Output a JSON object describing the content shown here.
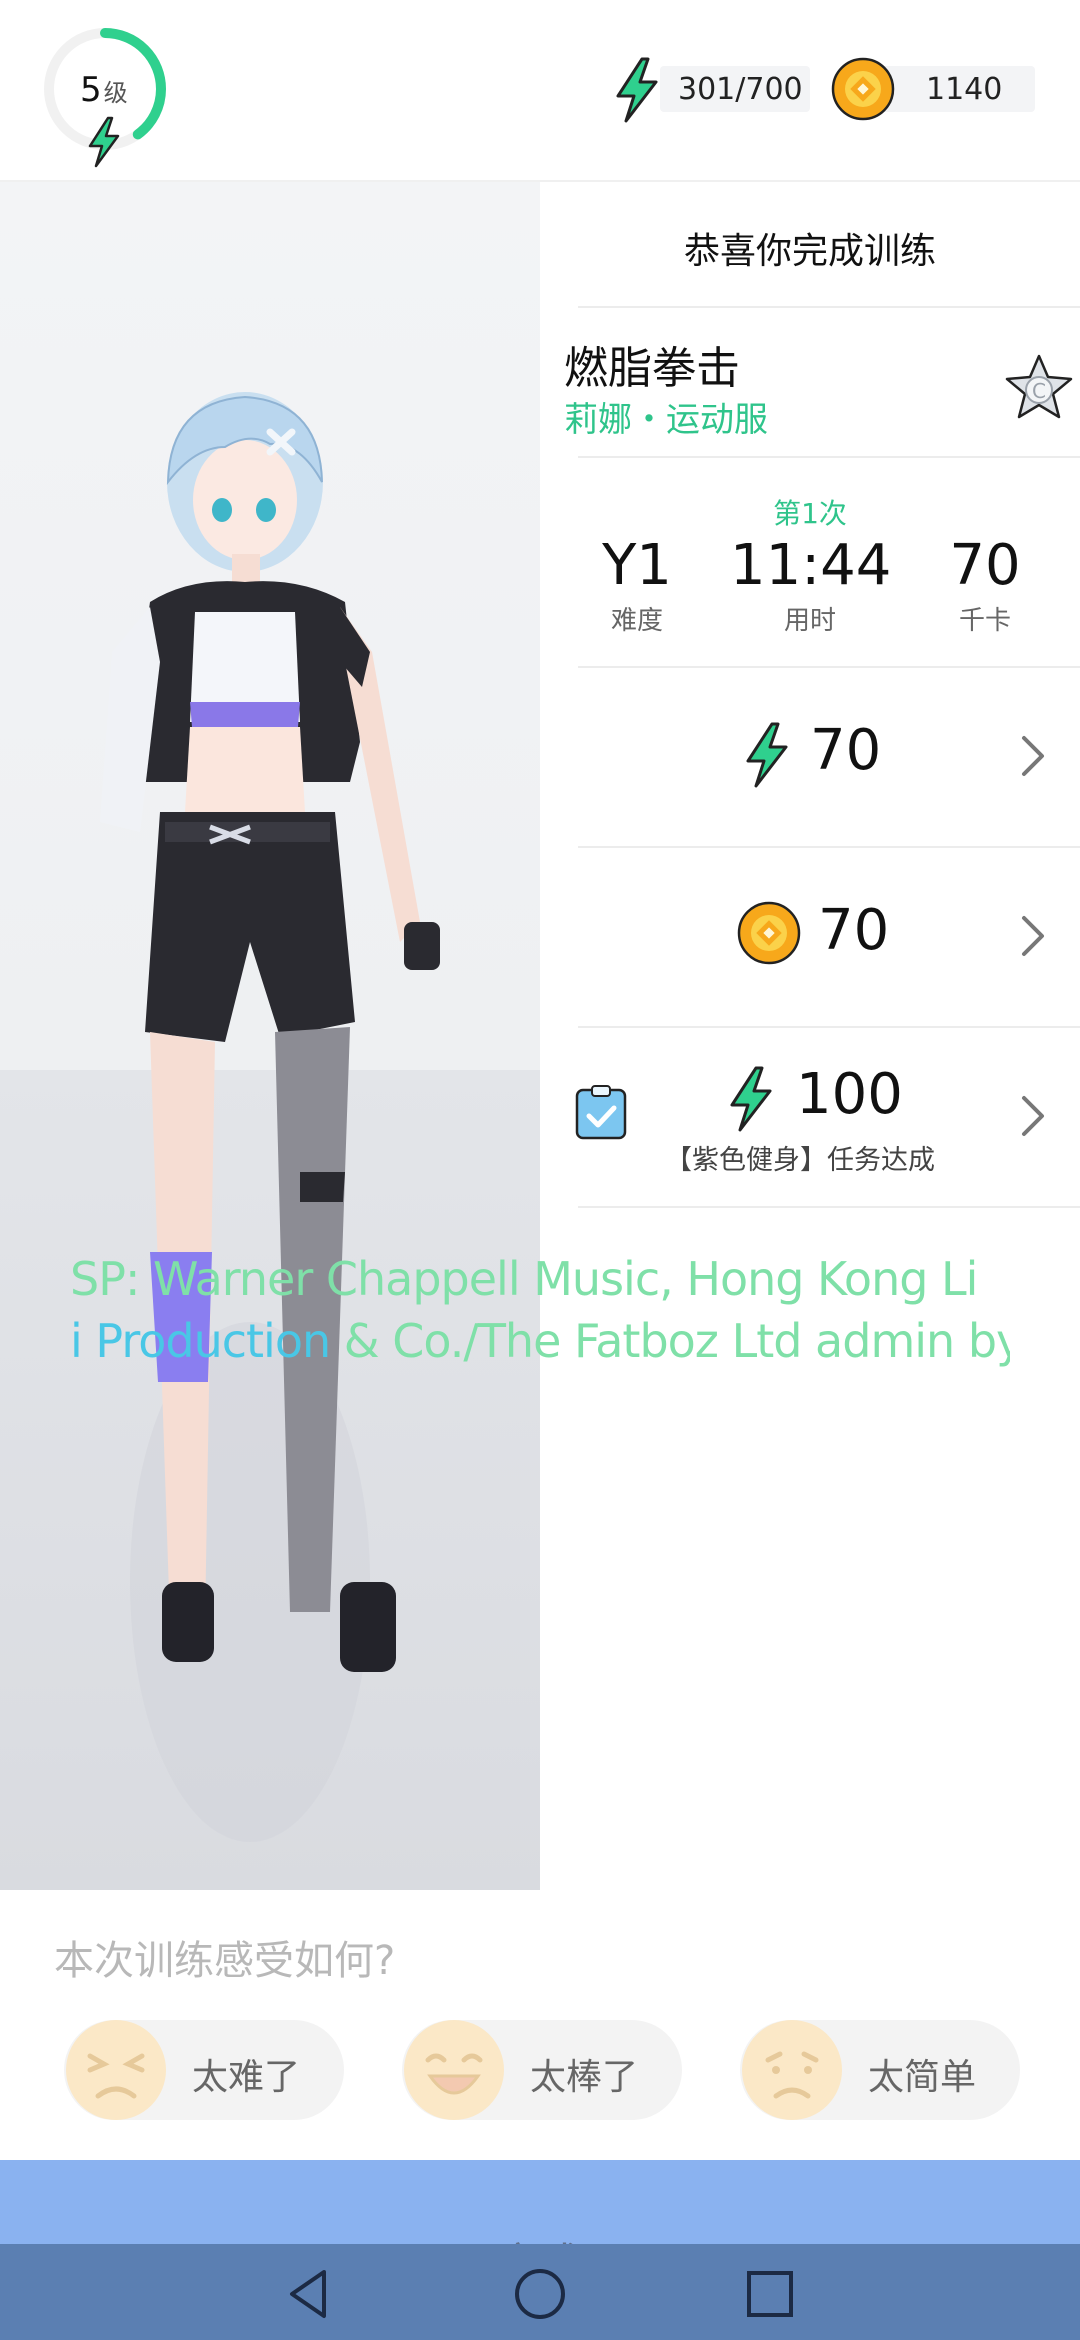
{
  "header": {
    "level_number": "5",
    "level_unit": "级",
    "energy": "301/700",
    "coins": "1140",
    "level_progress": 0.4
  },
  "result": {
    "congrats": "恭喜你完成训练",
    "workout_name": "燃脂拳击",
    "workout_subtitle": "莉娜・运动服",
    "grade": "C",
    "attempt": "第1次",
    "metrics": [
      {
        "value": "Y1",
        "label": "难度"
      },
      {
        "value": "11:44",
        "label": "用时"
      },
      {
        "value": "70",
        "label": "千卡"
      }
    ],
    "rewards": {
      "energy": "70",
      "coins": "70",
      "task_energy": "100",
      "task_text": "【紫色健身】任务达成"
    }
  },
  "credits": {
    "line1": "SP:   Warner Chappell Music, Hong Kong Li",
    "line2_start": "i Production",
    "line2_rest": " & Co./The Fatboz Ltd admin by"
  },
  "feedback": {
    "question": "本次训练感受如何?",
    "options": [
      "太难了",
      "太棒了",
      "太简单"
    ]
  },
  "footer": {
    "done_label": "完成"
  },
  "colors": {
    "accent_green": "#2fc48b",
    "coin_orange": "#f5a623",
    "button_blue": "#8ab2f0",
    "navbar_blue": "#5b7fb2"
  },
  "icons": [
    "lightning-icon",
    "coin-icon",
    "star-badge-icon",
    "chevron-right-icon",
    "clipboard-check-icon",
    "back-icon",
    "home-icon",
    "recents-icon"
  ]
}
